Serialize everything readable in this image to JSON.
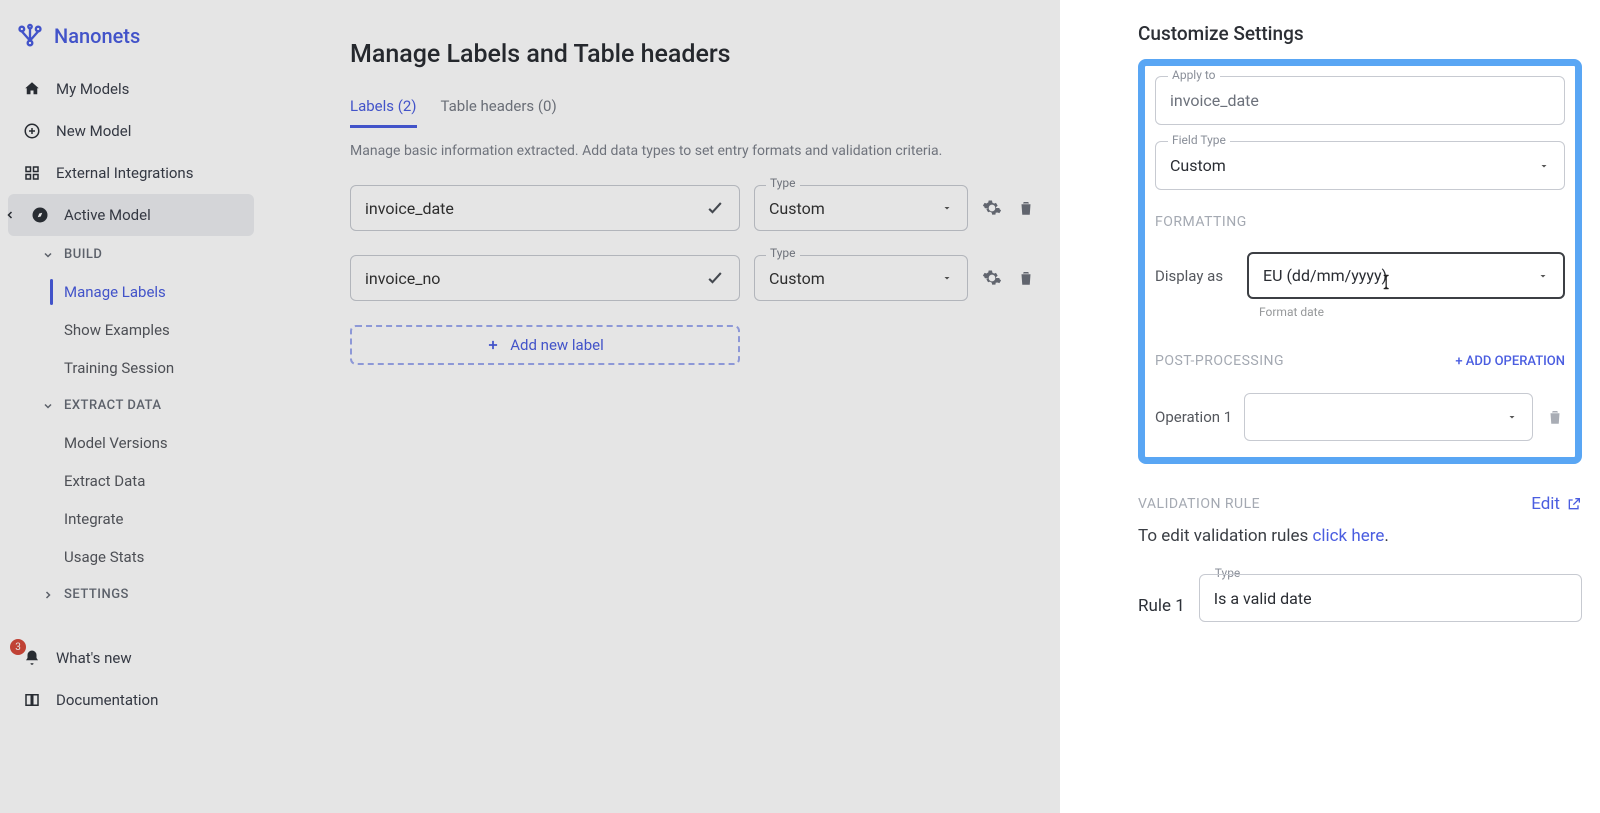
{
  "brand": "Nanonets",
  "sidebar": {
    "items": [
      {
        "label": "My Models"
      },
      {
        "label": "New Model"
      },
      {
        "label": "External Integrations"
      },
      {
        "label": "Active Model"
      }
    ],
    "sections": [
      {
        "title": "BUILD",
        "items": [
          {
            "label": "Manage Labels"
          },
          {
            "label": "Show Examples"
          },
          {
            "label": "Training Session"
          }
        ]
      },
      {
        "title": "EXTRACT DATA",
        "items": [
          {
            "label": "Model Versions"
          },
          {
            "label": "Extract Data"
          },
          {
            "label": "Integrate"
          },
          {
            "label": "Usage Stats"
          }
        ]
      },
      {
        "title": "SETTINGS",
        "items": []
      }
    ],
    "footer": [
      {
        "label": "What's new",
        "badge": "3"
      },
      {
        "label": "Documentation"
      }
    ]
  },
  "main": {
    "title": "Manage Labels and Table headers",
    "tabs": [
      {
        "label": "Labels (2)"
      },
      {
        "label": "Table headers (0)"
      }
    ],
    "helper": "Manage basic information extracted. Add data types to set entry formats and validation criteria.",
    "type_label": "Type",
    "rows": [
      {
        "name": "invoice_date",
        "type": "Custom"
      },
      {
        "name": "invoice_no",
        "type": "Custom"
      }
    ],
    "add_label": "Add new label"
  },
  "panel": {
    "title": "Customize Settings",
    "apply_to_label": "Apply to",
    "apply_to_value": "invoice_date",
    "field_type_label": "Field Type",
    "field_type_value": "Custom",
    "formatting_title": "FORMATTING",
    "display_as_label": "Display as",
    "display_as_value": "EU (dd/mm/yyyy)",
    "display_helper": "Format date",
    "post_title": "POST-PROCESSING",
    "add_op": "+ ADD OPERATION",
    "op1_label": "Operation 1",
    "validation_title": "VALIDATION RULE",
    "edit_label": "Edit",
    "validation_desc_pre": "To edit validation rules ",
    "validation_desc_link": "click here",
    "rule1_label": "Rule 1",
    "rule1_type_label": "Type",
    "rule1_value": "Is a valid date"
  }
}
